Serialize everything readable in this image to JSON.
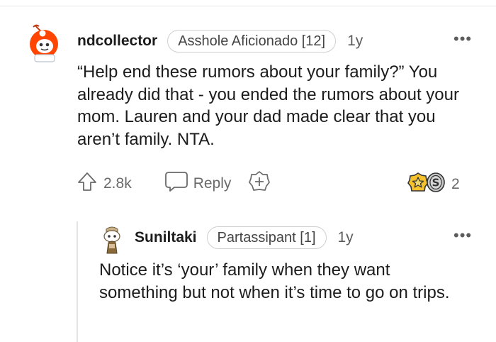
{
  "comments": [
    {
      "username": "ndcollector",
      "flair": "Asshole Aficionado [12]",
      "age": "1y",
      "more_icon": "more-horizontal-icon",
      "body": "“Help end these rumors about your family?” You already did that - you ended the rumors about your mom. Lauren and your dad made clear that you aren’t family. NTA.",
      "actions": {
        "upvote_icon": "upvote-arrow-icon",
        "vote_count": "2.8k",
        "reply_icon": "speech-bubble-icon",
        "reply_label": "Reply",
        "award_icon": "plus-award-icon",
        "award_badges": [
          "gold-star-award-icon",
          "silver-coin-award-icon"
        ],
        "award_count": "2"
      }
    },
    {
      "username": "Suniltaki",
      "flair": "Partassipant [1]",
      "age": "1y",
      "more_icon": "more-horizontal-icon",
      "body": "Notice it’s ‘your’ family when they want something but not when it’s time to go on trips."
    }
  ],
  "colors": {
    "avatar_orange": "#ff4500",
    "text": "#1c1c1c",
    "meta": "#5c5c5c",
    "border": "#cfcfcf"
  }
}
